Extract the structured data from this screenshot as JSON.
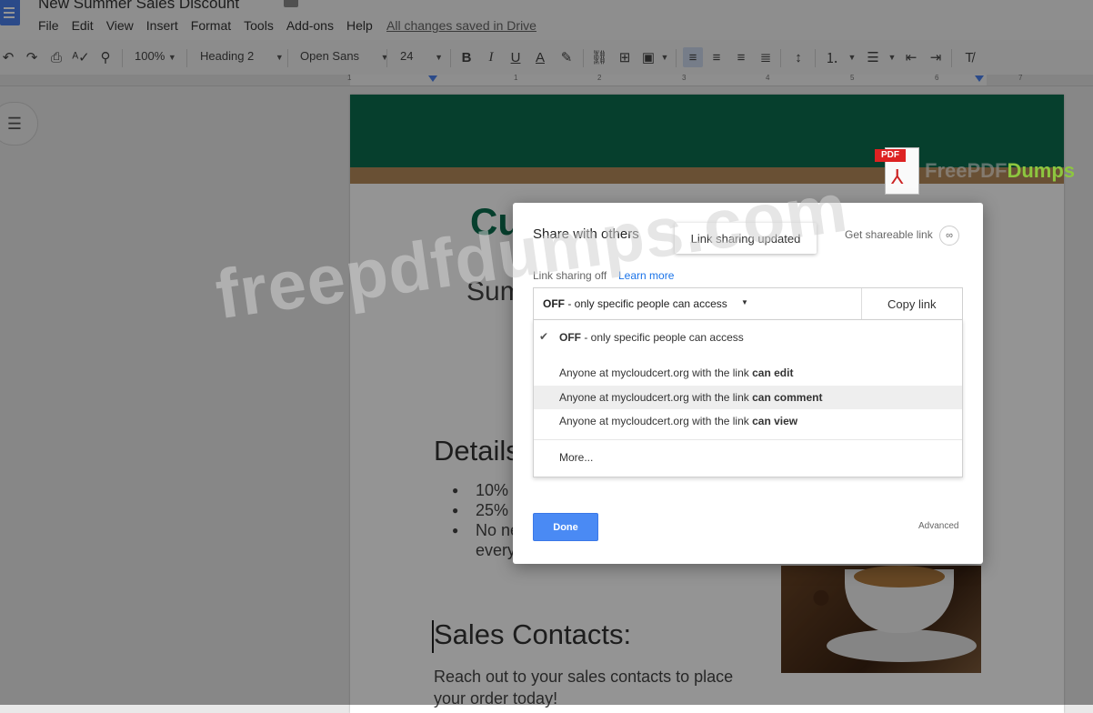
{
  "app": {
    "doc_title": "New Summer Sales Discount",
    "menu": [
      "File",
      "Edit",
      "View",
      "Insert",
      "Format",
      "Tools",
      "Add-ons",
      "Help"
    ],
    "saved_status": "All changes saved in Drive"
  },
  "toolbar": {
    "zoom": "100%",
    "style": "Heading 2",
    "font": "Open Sans",
    "font_size": "24"
  },
  "ruler": {
    "numbers": [
      "1",
      "1",
      "2",
      "3",
      "4",
      "5",
      "6",
      "7"
    ]
  },
  "document": {
    "heading": "Cu",
    "subheading": "Sum",
    "details_heading": "Details",
    "list": [
      "10% … origi…",
      "25% … signa…",
      "No need to worry about re-ordering every month!"
    ],
    "sales_heading": "Sales Contacts:",
    "paragraph": "Reach out to your sales contacts to place your order today!"
  },
  "watermark": {
    "pdf_tag": "PDF",
    "brand_prefix": "FreePDF",
    "brand_suffix": "Dumps",
    "big_text": "freepdfdumps.com"
  },
  "dialog": {
    "title": "Share with others",
    "toast": "Link sharing updated",
    "get_link": "Get shareable link",
    "link_sharing_status": "Link sharing off",
    "learn_more": "Learn more",
    "selected": {
      "bold": "OFF",
      "rest": " - only specific people can access"
    },
    "copy_link": "Copy link",
    "options": [
      {
        "prefix": "OFF",
        "text": " - only specific people can access",
        "suffix": ""
      },
      {
        "prefix": "",
        "text": "Anyone at mycloudcert.org with the link ",
        "suffix": "can edit"
      },
      {
        "prefix": "",
        "text": "Anyone at mycloudcert.org with the link ",
        "suffix": "can comment"
      },
      {
        "prefix": "",
        "text": "Anyone at mycloudcert.org with the link ",
        "suffix": "can view"
      },
      {
        "prefix": "",
        "text": "More...",
        "suffix": ""
      }
    ],
    "done": "Done",
    "advanced": "Advanced"
  },
  "colors": {
    "accent_blue": "#4a8af4",
    "doc_green": "#0b6d4e",
    "brand_green": "#8dc63f"
  }
}
